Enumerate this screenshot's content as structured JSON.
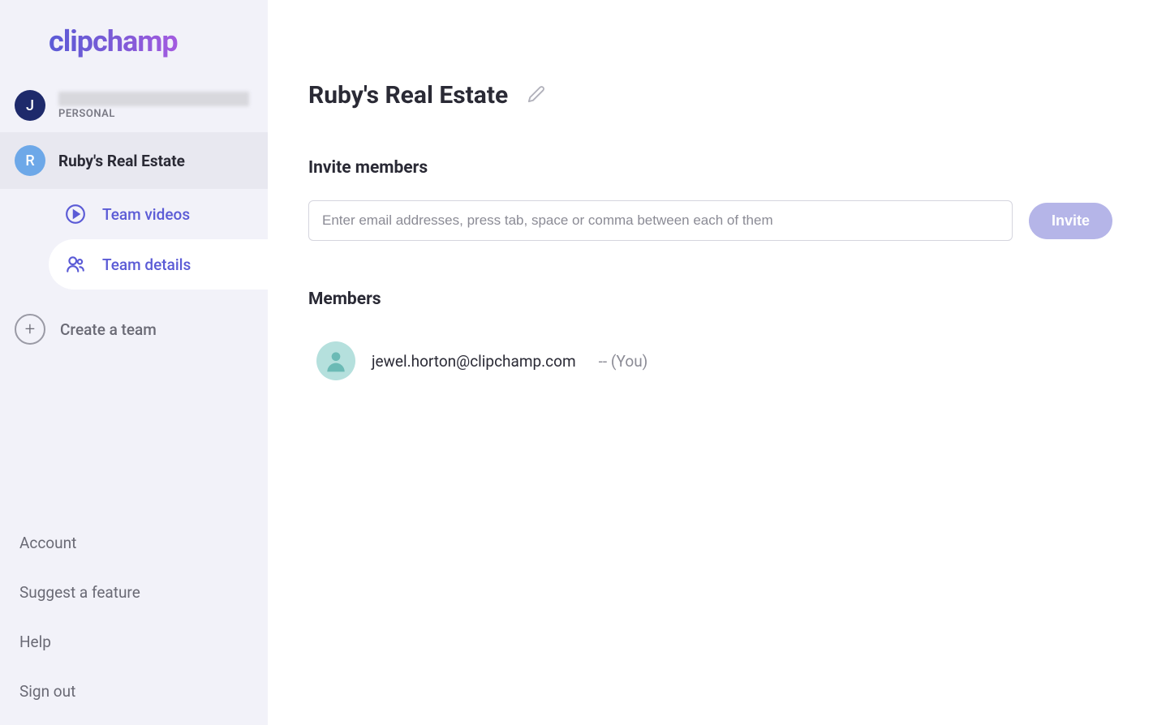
{
  "brand": {
    "name": "clipchamp"
  },
  "sidebar": {
    "personal": {
      "avatar_letter": "J",
      "label": "PERSONAL"
    },
    "workspace": {
      "avatar_letter": "R",
      "name": "Ruby's Real Estate"
    },
    "nav": {
      "team_videos": "Team videos",
      "team_details": "Team details"
    },
    "create_team": "Create a team",
    "footer": {
      "account": "Account",
      "suggest": "Suggest a feature",
      "help": "Help",
      "sign_out": "Sign out"
    }
  },
  "main": {
    "title": "Ruby's Real Estate",
    "invite": {
      "heading": "Invite members",
      "placeholder": "Enter email addresses, press tab, space or comma between each of them",
      "button": "Invite"
    },
    "members": {
      "heading": "Members",
      "list": [
        {
          "email": "jewel.horton@clipchamp.com",
          "suffix": "-- (You)"
        }
      ]
    }
  }
}
